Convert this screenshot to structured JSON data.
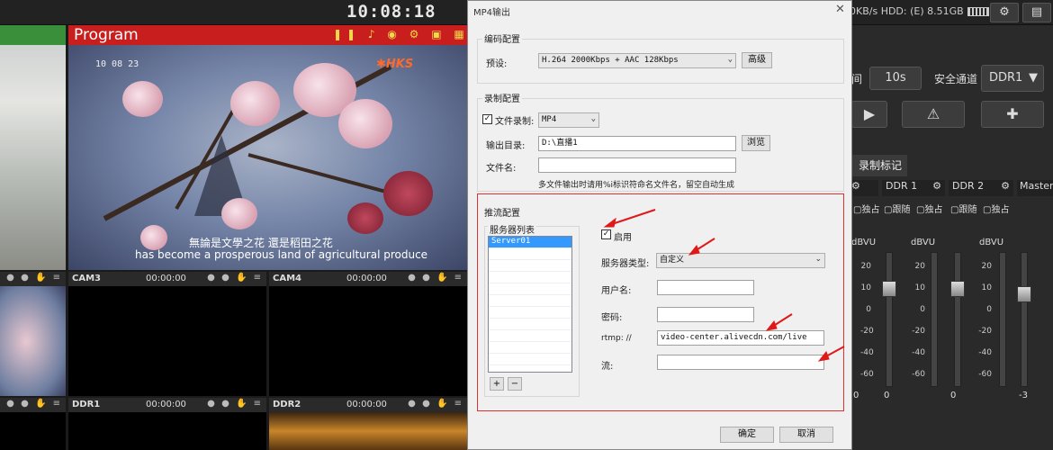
{
  "app": {
    "clock": "10:08:18",
    "status_text": "0KB/s  HDD: (E) 8.51GB",
    "program_label": "Program",
    "preview_timecode": "10 08 23",
    "logo_text": "HKS",
    "subtitle_line1": "無論是文學之花 還是稻田之花",
    "subtitle_line2": "has become a prosperous land of agricultural produce",
    "cams": [
      {
        "name": "CAM3",
        "time": "00:00:00"
      },
      {
        "name": "CAM4",
        "time": "00:00:00"
      },
      {
        "name": "DDR1",
        "time": "00:00:00"
      },
      {
        "name": "DDR2",
        "time": "00:00:00"
      }
    ],
    "right": {
      "interval_label": "间",
      "interval_value": "10s",
      "safe_channel_label": "安全通道",
      "safe_channel_value": "DDR1",
      "record_mark_tab": "录制标记",
      "channels": [
        {
          "name": "DDR 1",
          "solo": "独占",
          "follow": "跟随",
          "unit": "dBVU",
          "bottom": "0"
        },
        {
          "name": "DDR 2",
          "solo": "独占",
          "follow": "跟随",
          "unit": "dBVU",
          "bottom": "0"
        },
        {
          "name": "Master",
          "bottom": "-3"
        }
      ],
      "scale": [
        "20",
        "10",
        "0",
        "-20",
        "-40",
        "-60"
      ],
      "left_solo": "独占",
      "left_unit": "dBVU",
      "left_bottom": "0"
    }
  },
  "dialog": {
    "title": "MP4输出",
    "encode": {
      "group_title": "编码配置",
      "preset_label": "预设:",
      "preset_value": "H.264 2000Kbps + AAC 128Kbps",
      "advanced_button": "高级"
    },
    "record": {
      "group_title": "录制配置",
      "file_record_label": "文件录制:",
      "file_record_checked": true,
      "format_value": "MP4",
      "output_dir_label": "输出目录:",
      "output_dir_value": "D:\\直播1",
      "browse_button": "浏览",
      "filename_label": "文件名:",
      "filename_value": "",
      "hint": "多文件输出时请用%i标识符命名文件名，留空自动生成"
    },
    "stream": {
      "group_title": "推流配置",
      "server_list_title": "服务器列表",
      "servers": [
        "Server01"
      ],
      "add_button": "+",
      "remove_button": "−",
      "enable_label": "启用",
      "enable_checked": true,
      "server_type_label": "服务器类型:",
      "server_type_value": "自定义",
      "username_label": "用户名:",
      "username_value": "",
      "password_label": "密码:",
      "password_value": "",
      "rtmp_label": "rtmp: //",
      "rtmp_value": "video-center.alivecdn.com/live",
      "stream_label": "流:",
      "stream_value": ""
    },
    "ok_button": "确定",
    "cancel_button": "取消"
  }
}
